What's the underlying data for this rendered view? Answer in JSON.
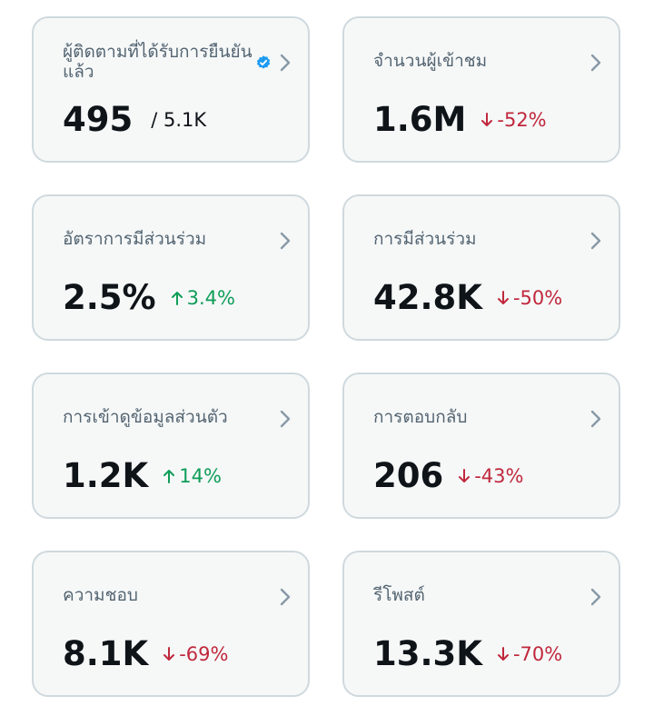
{
  "colors": {
    "card_bg": "#f6f8f8",
    "card_border": "#cfd9de",
    "label": "#536471",
    "value": "#0f1419",
    "down": "#c0283c",
    "up": "#0f9d58",
    "verified": "#1d9bf0"
  },
  "cards": [
    {
      "label": "ผู้ติดตามที่ได้รับการยืนยันแล้ว",
      "value": "495",
      "sub": "/ 5.1K",
      "icon": "verified-badge-icon"
    },
    {
      "label": "จำนวนผู้เข้าชม",
      "value": "1.6M",
      "change": "-52%",
      "direction": "down"
    },
    {
      "label": "อัตราการมีส่วนร่วม",
      "value": "2.5%",
      "change": "3.4%",
      "direction": "up"
    },
    {
      "label": "การมีส่วนร่วม",
      "value": "42.8K",
      "change": "-50%",
      "direction": "down"
    },
    {
      "label": "การเข้าดูข้อมูลส่วนตัว",
      "value": "1.2K",
      "change": "14%",
      "direction": "up"
    },
    {
      "label": "การตอบกลับ",
      "value": "206",
      "change": "-43%",
      "direction": "down"
    },
    {
      "label": "ความชอบ",
      "value": "8.1K",
      "change": "-69%",
      "direction": "down"
    },
    {
      "label": "รีโพสต์",
      "value": "13.3K",
      "change": "-70%",
      "direction": "down"
    }
  ]
}
